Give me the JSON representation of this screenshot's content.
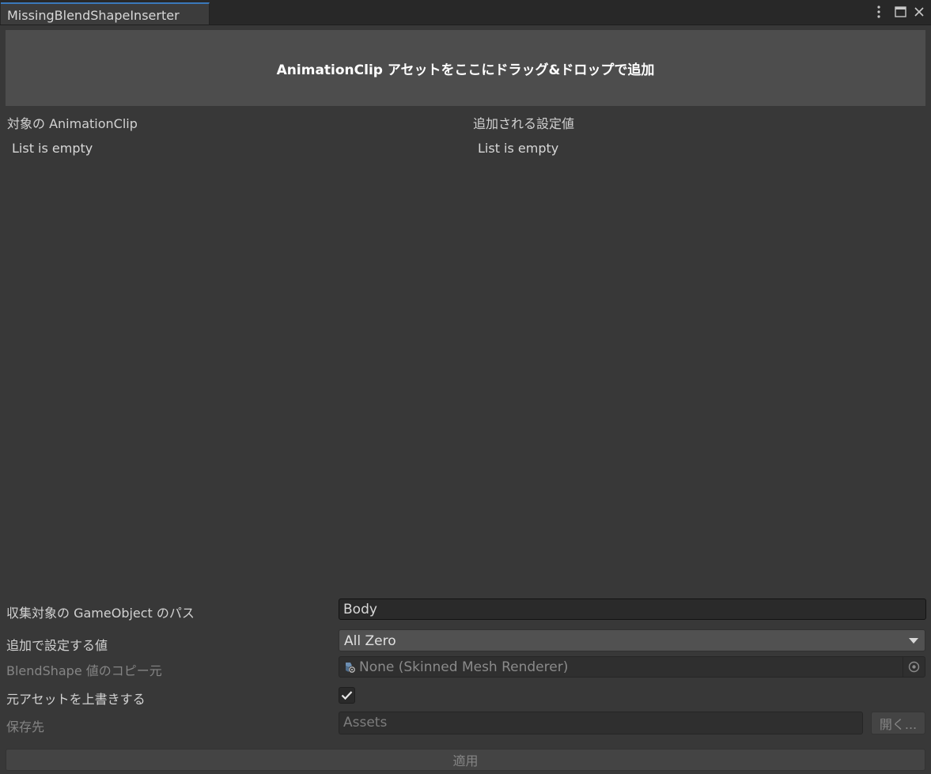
{
  "window": {
    "tab_title": "MissingBlendShapeInserter"
  },
  "dropzone": {
    "label": "AnimationClip アセットをここにドラッグ&ドロップで追加"
  },
  "lists": {
    "left_header": "対象の AnimationClip",
    "left_empty": "List is empty",
    "right_header": "追加される設定値",
    "right_empty": "List is empty"
  },
  "form": {
    "path_label": "収集対象の GameObject のパス",
    "path_value": "Body",
    "mode_label": "追加で設定する値",
    "mode_value": "All Zero",
    "source_label": "BlendShape 値のコピー元",
    "source_value": "None (Skinned Mesh Renderer)",
    "overwrite_label": "元アセットを上書きする",
    "overwrite_checked": true,
    "save_label": "保存先",
    "save_value": "Assets",
    "open_button": "開く...",
    "apply_button": "適用"
  },
  "icons": {
    "kebab": "kebab-menu-icon",
    "maximize": "maximize-icon",
    "close": "close-icon",
    "renderer": "skinned-mesh-renderer-icon",
    "picker": "object-picker-icon",
    "check": "checkmark-icon"
  }
}
